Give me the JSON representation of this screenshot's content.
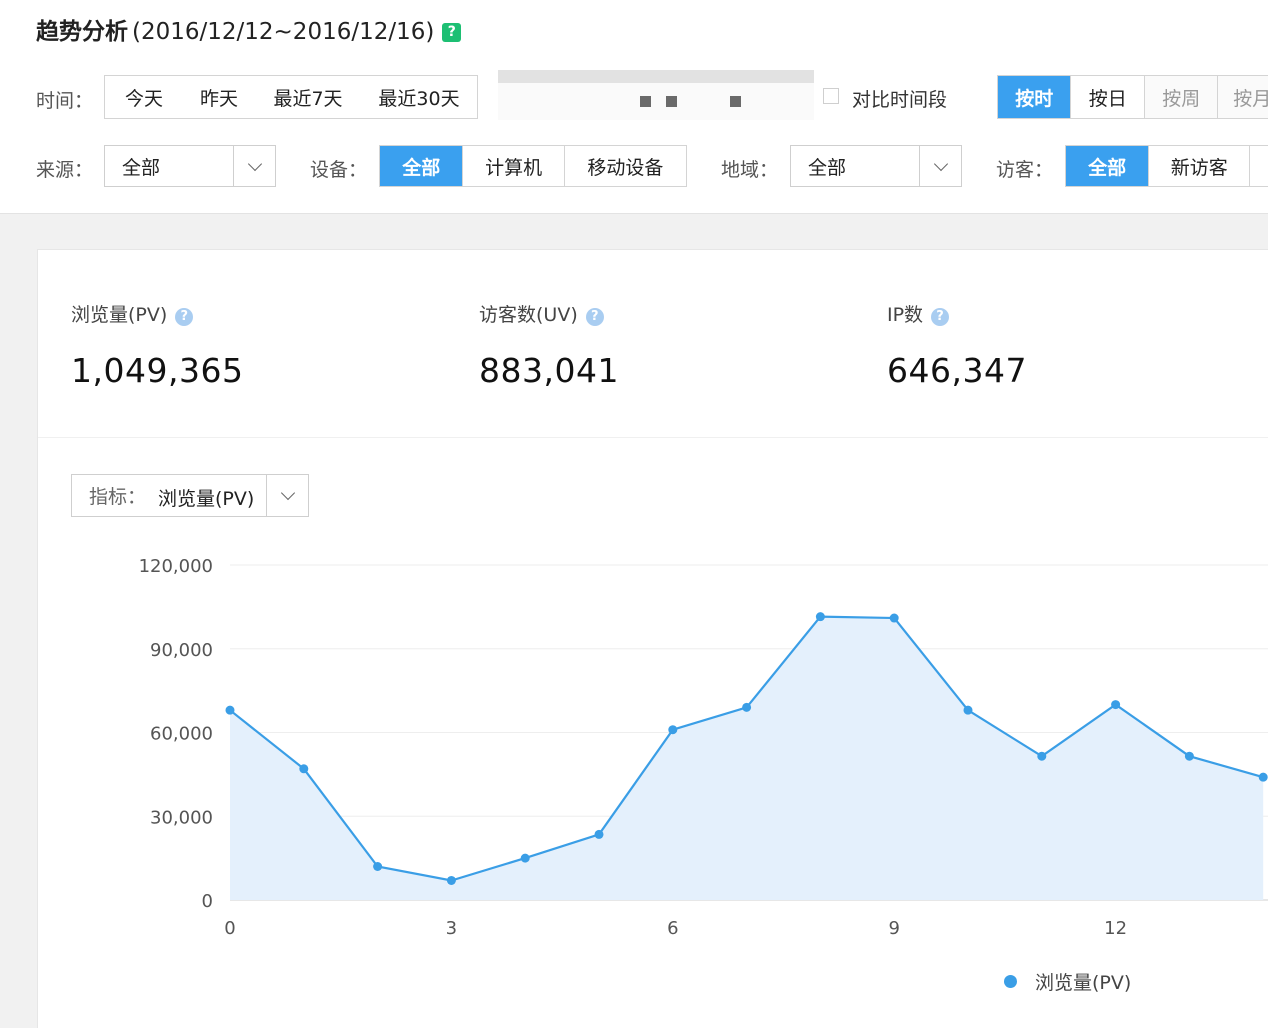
{
  "header": {
    "title": "趋势分析",
    "date_range": "(2016/12/12~2016/12/16)",
    "help": "?"
  },
  "time_filter": {
    "label": "时间：",
    "options": [
      "今天",
      "昨天",
      "最近7天",
      "最近30天"
    ]
  },
  "compare": {
    "label": "对比时间段"
  },
  "granularity": {
    "options": [
      "按时",
      "按日",
      "按周",
      "按月"
    ],
    "active_index": 0
  },
  "source": {
    "label": "来源：",
    "value": "全部"
  },
  "device": {
    "label": "设备：",
    "options": [
      "全部",
      "计算机",
      "移动设备"
    ],
    "active_index": 0
  },
  "region": {
    "label": "地域：",
    "value": "全部"
  },
  "visitor": {
    "label": "访客：",
    "options": [
      "全部",
      "新访客"
    ],
    "active_index": 0
  },
  "metrics": [
    {
      "label": "浏览量(PV)",
      "value": "1,049,365"
    },
    {
      "label": "访客数(UV)",
      "value": "883,041"
    },
    {
      "label": "IP数",
      "value": "646,347"
    }
  ],
  "indicator": {
    "label": "指标：",
    "value": "浏览量(PV)"
  },
  "colors": {
    "accent": "#3aa0ef",
    "series_line": "#3a9ee6",
    "area_fill": "#e4f0fc",
    "help_green": "#1dbf73"
  },
  "chart_data": {
    "type": "area",
    "x": [
      0,
      1,
      2,
      3,
      4,
      5,
      6,
      7,
      8,
      9,
      10,
      11,
      12,
      13,
      14
    ],
    "series": [
      {
        "name": "浏览量(PV)",
        "values": [
          68000,
          47000,
          12000,
          7000,
          15000,
          23500,
          61000,
          69000,
          101500,
          101000,
          68000,
          51500,
          70000,
          51500,
          44000
        ]
      }
    ],
    "x_ticks": [
      0,
      3,
      6,
      9,
      12
    ],
    "y_ticks": [
      0,
      30000,
      60000,
      90000,
      120000
    ],
    "y_tick_labels": [
      "0",
      "30,000",
      "60,000",
      "90,000",
      "120,000"
    ],
    "ylim": [
      0,
      120000
    ],
    "grid": true,
    "legend": "bottom-right"
  }
}
